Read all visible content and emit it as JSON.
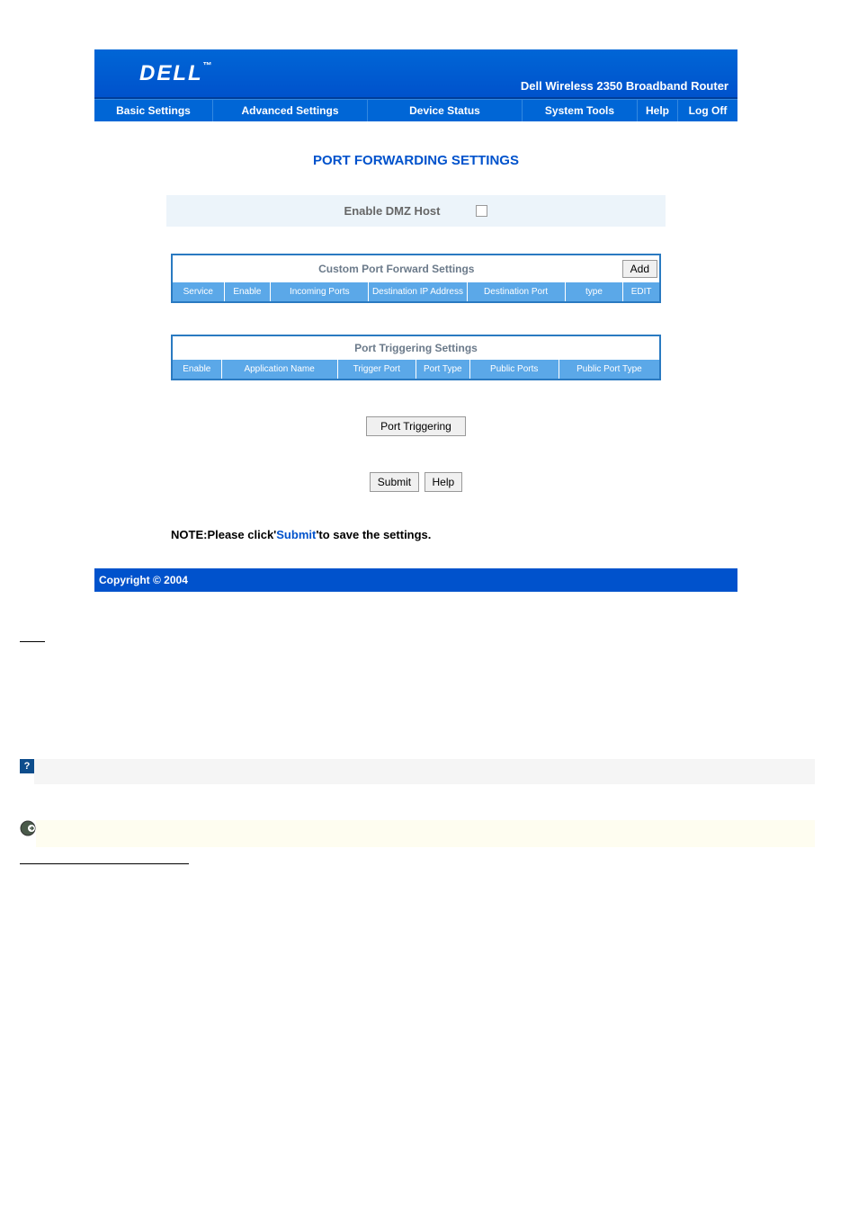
{
  "header": {
    "logo": "DELL",
    "logo_tm": "™",
    "product_name": "Dell Wireless 2350 Broadband Router"
  },
  "nav": {
    "items": [
      "Basic Settings",
      "Advanced Settings",
      "Device Status",
      "System Tools",
      "Help",
      "Log Off"
    ]
  },
  "page": {
    "title": "PORT FORWARDING SETTINGS"
  },
  "dmz": {
    "label": "Enable DMZ Host",
    "checked": false
  },
  "custom_port_forward": {
    "title": "Custom Port Forward Settings",
    "add_button": "Add",
    "columns": [
      "Service",
      "Enable",
      "Incoming Ports",
      "Destination IP Address",
      "Destination Port",
      "type",
      "EDIT"
    ]
  },
  "port_triggering": {
    "title": "Port Triggering Settings",
    "columns": [
      "Enable",
      "Application Name",
      "Trigger Port",
      "Port Type",
      "Public Ports",
      "Public Port Type"
    ]
  },
  "buttons": {
    "port_triggering": "Port Triggering",
    "submit": "Submit",
    "help": "Help"
  },
  "note": {
    "prefix": "NOTE:Please click'",
    "submit_word": "Submit",
    "suffix": "'to save the settings."
  },
  "footer": {
    "copyright": "Copyright © 2004"
  },
  "icons": {
    "question": "?"
  }
}
